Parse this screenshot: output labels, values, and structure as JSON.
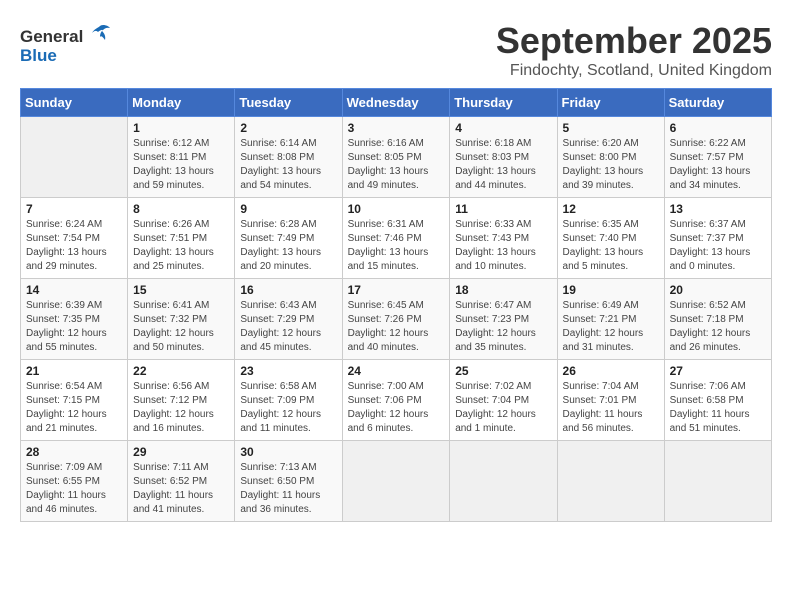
{
  "logo": {
    "line1": "General",
    "line2": "Blue"
  },
  "header": {
    "month_year": "September 2025",
    "location": "Findochty, Scotland, United Kingdom"
  },
  "days_of_week": [
    "Sunday",
    "Monday",
    "Tuesday",
    "Wednesday",
    "Thursday",
    "Friday",
    "Saturday"
  ],
  "weeks": [
    [
      {
        "day": "",
        "empty": true
      },
      {
        "day": "1",
        "sunrise": "Sunrise: 6:12 AM",
        "sunset": "Sunset: 8:11 PM",
        "daylight": "Daylight: 13 hours and 59 minutes."
      },
      {
        "day": "2",
        "sunrise": "Sunrise: 6:14 AM",
        "sunset": "Sunset: 8:08 PM",
        "daylight": "Daylight: 13 hours and 54 minutes."
      },
      {
        "day": "3",
        "sunrise": "Sunrise: 6:16 AM",
        "sunset": "Sunset: 8:05 PM",
        "daylight": "Daylight: 13 hours and 49 minutes."
      },
      {
        "day": "4",
        "sunrise": "Sunrise: 6:18 AM",
        "sunset": "Sunset: 8:03 PM",
        "daylight": "Daylight: 13 hours and 44 minutes."
      },
      {
        "day": "5",
        "sunrise": "Sunrise: 6:20 AM",
        "sunset": "Sunset: 8:00 PM",
        "daylight": "Daylight: 13 hours and 39 minutes."
      },
      {
        "day": "6",
        "sunrise": "Sunrise: 6:22 AM",
        "sunset": "Sunset: 7:57 PM",
        "daylight": "Daylight: 13 hours and 34 minutes."
      }
    ],
    [
      {
        "day": "7",
        "sunrise": "Sunrise: 6:24 AM",
        "sunset": "Sunset: 7:54 PM",
        "daylight": "Daylight: 13 hours and 29 minutes."
      },
      {
        "day": "8",
        "sunrise": "Sunrise: 6:26 AM",
        "sunset": "Sunset: 7:51 PM",
        "daylight": "Daylight: 13 hours and 25 minutes."
      },
      {
        "day": "9",
        "sunrise": "Sunrise: 6:28 AM",
        "sunset": "Sunset: 7:49 PM",
        "daylight": "Daylight: 13 hours and 20 minutes."
      },
      {
        "day": "10",
        "sunrise": "Sunrise: 6:31 AM",
        "sunset": "Sunset: 7:46 PM",
        "daylight": "Daylight: 13 hours and 15 minutes."
      },
      {
        "day": "11",
        "sunrise": "Sunrise: 6:33 AM",
        "sunset": "Sunset: 7:43 PM",
        "daylight": "Daylight: 13 hours and 10 minutes."
      },
      {
        "day": "12",
        "sunrise": "Sunrise: 6:35 AM",
        "sunset": "Sunset: 7:40 PM",
        "daylight": "Daylight: 13 hours and 5 minutes."
      },
      {
        "day": "13",
        "sunrise": "Sunrise: 6:37 AM",
        "sunset": "Sunset: 7:37 PM",
        "daylight": "Daylight: 13 hours and 0 minutes."
      }
    ],
    [
      {
        "day": "14",
        "sunrise": "Sunrise: 6:39 AM",
        "sunset": "Sunset: 7:35 PM",
        "daylight": "Daylight: 12 hours and 55 minutes."
      },
      {
        "day": "15",
        "sunrise": "Sunrise: 6:41 AM",
        "sunset": "Sunset: 7:32 PM",
        "daylight": "Daylight: 12 hours and 50 minutes."
      },
      {
        "day": "16",
        "sunrise": "Sunrise: 6:43 AM",
        "sunset": "Sunset: 7:29 PM",
        "daylight": "Daylight: 12 hours and 45 minutes."
      },
      {
        "day": "17",
        "sunrise": "Sunrise: 6:45 AM",
        "sunset": "Sunset: 7:26 PM",
        "daylight": "Daylight: 12 hours and 40 minutes."
      },
      {
        "day": "18",
        "sunrise": "Sunrise: 6:47 AM",
        "sunset": "Sunset: 7:23 PM",
        "daylight": "Daylight: 12 hours and 35 minutes."
      },
      {
        "day": "19",
        "sunrise": "Sunrise: 6:49 AM",
        "sunset": "Sunset: 7:21 PM",
        "daylight": "Daylight: 12 hours and 31 minutes."
      },
      {
        "day": "20",
        "sunrise": "Sunrise: 6:52 AM",
        "sunset": "Sunset: 7:18 PM",
        "daylight": "Daylight: 12 hours and 26 minutes."
      }
    ],
    [
      {
        "day": "21",
        "sunrise": "Sunrise: 6:54 AM",
        "sunset": "Sunset: 7:15 PM",
        "daylight": "Daylight: 12 hours and 21 minutes."
      },
      {
        "day": "22",
        "sunrise": "Sunrise: 6:56 AM",
        "sunset": "Sunset: 7:12 PM",
        "daylight": "Daylight: 12 hours and 16 minutes."
      },
      {
        "day": "23",
        "sunrise": "Sunrise: 6:58 AM",
        "sunset": "Sunset: 7:09 PM",
        "daylight": "Daylight: 12 hours and 11 minutes."
      },
      {
        "day": "24",
        "sunrise": "Sunrise: 7:00 AM",
        "sunset": "Sunset: 7:06 PM",
        "daylight": "Daylight: 12 hours and 6 minutes."
      },
      {
        "day": "25",
        "sunrise": "Sunrise: 7:02 AM",
        "sunset": "Sunset: 7:04 PM",
        "daylight": "Daylight: 12 hours and 1 minute."
      },
      {
        "day": "26",
        "sunrise": "Sunrise: 7:04 AM",
        "sunset": "Sunset: 7:01 PM",
        "daylight": "Daylight: 11 hours and 56 minutes."
      },
      {
        "day": "27",
        "sunrise": "Sunrise: 7:06 AM",
        "sunset": "Sunset: 6:58 PM",
        "daylight": "Daylight: 11 hours and 51 minutes."
      }
    ],
    [
      {
        "day": "28",
        "sunrise": "Sunrise: 7:09 AM",
        "sunset": "Sunset: 6:55 PM",
        "daylight": "Daylight: 11 hours and 46 minutes."
      },
      {
        "day": "29",
        "sunrise": "Sunrise: 7:11 AM",
        "sunset": "Sunset: 6:52 PM",
        "daylight": "Daylight: 11 hours and 41 minutes."
      },
      {
        "day": "30",
        "sunrise": "Sunrise: 7:13 AM",
        "sunset": "Sunset: 6:50 PM",
        "daylight": "Daylight: 11 hours and 36 minutes."
      },
      {
        "day": "",
        "empty": true
      },
      {
        "day": "",
        "empty": true
      },
      {
        "day": "",
        "empty": true
      },
      {
        "day": "",
        "empty": true
      }
    ]
  ]
}
